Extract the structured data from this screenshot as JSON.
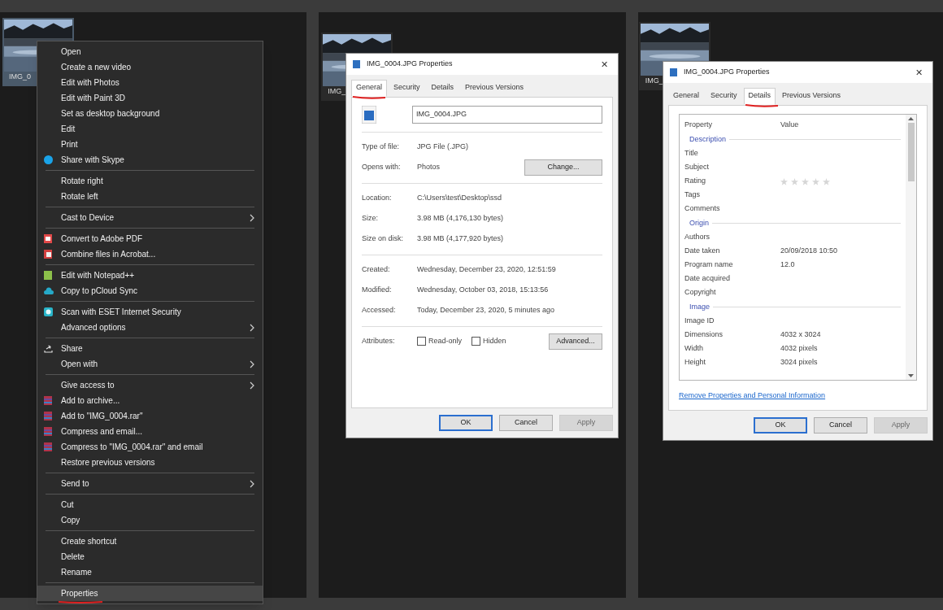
{
  "panels": [
    {
      "thumbnail_label": "IMG_0",
      "selected": true
    },
    {
      "thumbnail_label": "IMG_",
      "selected": false
    },
    {
      "thumbnail_label": "IMG_",
      "selected": false
    }
  ],
  "context_menu": {
    "items": [
      {
        "kind": "item",
        "label": "Open",
        "submenu": false,
        "selected": false
      },
      {
        "kind": "item",
        "label": "Create a new video",
        "submenu": false,
        "selected": false
      },
      {
        "kind": "item",
        "label": "Edit with Photos",
        "submenu": false,
        "selected": false
      },
      {
        "kind": "item",
        "label": "Edit with Paint 3D",
        "submenu": false,
        "selected": false
      },
      {
        "kind": "item",
        "label": "Set as desktop background",
        "submenu": false,
        "selected": false
      },
      {
        "kind": "item",
        "label": "Edit",
        "submenu": false,
        "selected": false
      },
      {
        "kind": "item",
        "label": "Print",
        "submenu": false,
        "selected": false
      },
      {
        "kind": "item",
        "label": "Share with Skype",
        "submenu": false,
        "selected": false
      },
      {
        "kind": "separator"
      },
      {
        "kind": "item",
        "label": "Rotate right",
        "submenu": false,
        "selected": false
      },
      {
        "kind": "item",
        "label": "Rotate left",
        "submenu": false,
        "selected": false
      },
      {
        "kind": "separator"
      },
      {
        "kind": "item",
        "label": "Cast to Device",
        "submenu": true,
        "selected": false
      },
      {
        "kind": "separator"
      },
      {
        "kind": "item",
        "label": "Convert to Adobe PDF",
        "submenu": false,
        "selected": false
      },
      {
        "kind": "item",
        "label": "Combine files in Acrobat...",
        "submenu": false,
        "selected": false
      },
      {
        "kind": "separator"
      },
      {
        "kind": "item",
        "label": "Edit with Notepad++",
        "submenu": false,
        "selected": false
      },
      {
        "kind": "item",
        "label": "Copy to pCloud Sync",
        "submenu": false,
        "selected": false
      },
      {
        "kind": "separator"
      },
      {
        "kind": "item",
        "label": "Scan with ESET Internet Security",
        "submenu": false,
        "selected": false
      },
      {
        "kind": "item",
        "label": "Advanced options",
        "submenu": true,
        "selected": false
      },
      {
        "kind": "separator"
      },
      {
        "kind": "item",
        "label": "Share",
        "submenu": false,
        "selected": false
      },
      {
        "kind": "item",
        "label": "Open with",
        "submenu": true,
        "selected": false
      },
      {
        "kind": "separator"
      },
      {
        "kind": "item",
        "label": "Give access to",
        "submenu": true,
        "selected": false
      },
      {
        "kind": "item",
        "label": "Add to archive...",
        "submenu": false,
        "selected": false
      },
      {
        "kind": "item",
        "label": "Add to \"IMG_0004.rar\"",
        "submenu": false,
        "selected": false
      },
      {
        "kind": "item",
        "label": "Compress and email...",
        "submenu": false,
        "selected": false
      },
      {
        "kind": "item",
        "label": "Compress to \"IMG_0004.rar\" and email",
        "submenu": false,
        "selected": false
      },
      {
        "kind": "item",
        "label": "Restore previous versions",
        "submenu": false,
        "selected": false
      },
      {
        "kind": "separator"
      },
      {
        "kind": "item",
        "label": "Send to",
        "submenu": true,
        "selected": false
      },
      {
        "kind": "separator"
      },
      {
        "kind": "item",
        "label": "Cut",
        "submenu": false,
        "selected": false
      },
      {
        "kind": "item",
        "label": "Copy",
        "submenu": false,
        "selected": false
      },
      {
        "kind": "separator"
      },
      {
        "kind": "item",
        "label": "Create shortcut",
        "submenu": false,
        "selected": false
      },
      {
        "kind": "item",
        "label": "Delete",
        "submenu": false,
        "selected": false
      },
      {
        "kind": "item",
        "label": "Rename",
        "submenu": false,
        "selected": false
      },
      {
        "kind": "separator"
      },
      {
        "kind": "item",
        "label": "Properties",
        "submenu": false,
        "selected": true
      }
    ]
  },
  "general_dialog": {
    "title": "IMG_0004.JPG Properties",
    "close": "✕",
    "tabs": [
      {
        "label": "General",
        "selected": true
      },
      {
        "label": "Security",
        "selected": false
      },
      {
        "label": "Details",
        "selected": false
      },
      {
        "label": "Previous Versions",
        "selected": false
      }
    ],
    "filename": "IMG_0004.JPG",
    "sections": [
      [
        {
          "label": "Type of file:",
          "value": "JPG File (.JPG)"
        },
        {
          "label": "Opens with:",
          "value": "Photos",
          "button": "Change..."
        }
      ],
      [
        {
          "label": "Location:",
          "value": "C:\\Users\\test\\Desktop\\ssd"
        },
        {
          "label": "Size:",
          "value": "3.98 MB (4,176,130 bytes)"
        },
        {
          "label": "Size on disk:",
          "value": "3.98 MB (4,177,920 bytes)"
        }
      ],
      [
        {
          "label": "Created:",
          "value": "Wednesday, December 23, 2020, 12:51:59"
        },
        {
          "label": "Modified:",
          "value": "Wednesday, October 03, 2018, 15:13:56"
        },
        {
          "label": "Accessed:",
          "value": "Today, December 23, 2020, 5 minutes ago"
        }
      ]
    ],
    "attributes": {
      "label": "Attributes:",
      "checkboxes": [
        {
          "label": "Read-only",
          "checked": false
        },
        {
          "label": "Hidden",
          "checked": false
        }
      ],
      "button": "Advanced..."
    },
    "buttons": [
      {
        "label": "OK",
        "disabled": false,
        "default": true
      },
      {
        "label": "Cancel",
        "disabled": false,
        "default": false
      },
      {
        "label": "Apply",
        "disabled": true,
        "default": false
      }
    ]
  },
  "details_dialog": {
    "title": "IMG_0004.JPG Properties",
    "close": "✕",
    "tabs": [
      {
        "label": "General",
        "selected": false
      },
      {
        "label": "Security",
        "selected": false
      },
      {
        "label": "Details",
        "selected": true
      },
      {
        "label": "Previous Versions",
        "selected": false
      }
    ],
    "columns": [
      "Property",
      "Value"
    ],
    "rows": [
      {
        "kind": "group",
        "label": "Description"
      },
      {
        "kind": "field",
        "label": "Title"
      },
      {
        "kind": "field",
        "label": "Subject"
      },
      {
        "kind": "rating",
        "label": "Rating",
        "stars": 0
      },
      {
        "kind": "field",
        "label": "Tags"
      },
      {
        "kind": "field",
        "label": "Comments"
      },
      {
        "kind": "group",
        "label": "Origin"
      },
      {
        "kind": "field",
        "label": "Authors"
      },
      {
        "kind": "field",
        "label": "Date taken",
        "value": "20/09/2018 10:50"
      },
      {
        "kind": "field",
        "label": "Program name",
        "value": "12.0"
      },
      {
        "kind": "field",
        "label": "Date acquired"
      },
      {
        "kind": "field",
        "label": "Copyright"
      },
      {
        "kind": "group",
        "label": "Image"
      },
      {
        "kind": "field",
        "label": "Image ID"
      },
      {
        "kind": "field",
        "label": "Dimensions",
        "value": "4032 x 3024"
      },
      {
        "kind": "field",
        "label": "Width",
        "value": "4032 pixels"
      },
      {
        "kind": "field",
        "label": "Height",
        "value": "3024 pixels"
      }
    ],
    "link": "Remove Properties and Personal Information",
    "buttons": [
      {
        "label": "OK",
        "disabled": false,
        "default": true
      },
      {
        "label": "Cancel",
        "disabled": false,
        "default": false
      },
      {
        "label": "Apply",
        "disabled": true,
        "default": false
      }
    ]
  }
}
